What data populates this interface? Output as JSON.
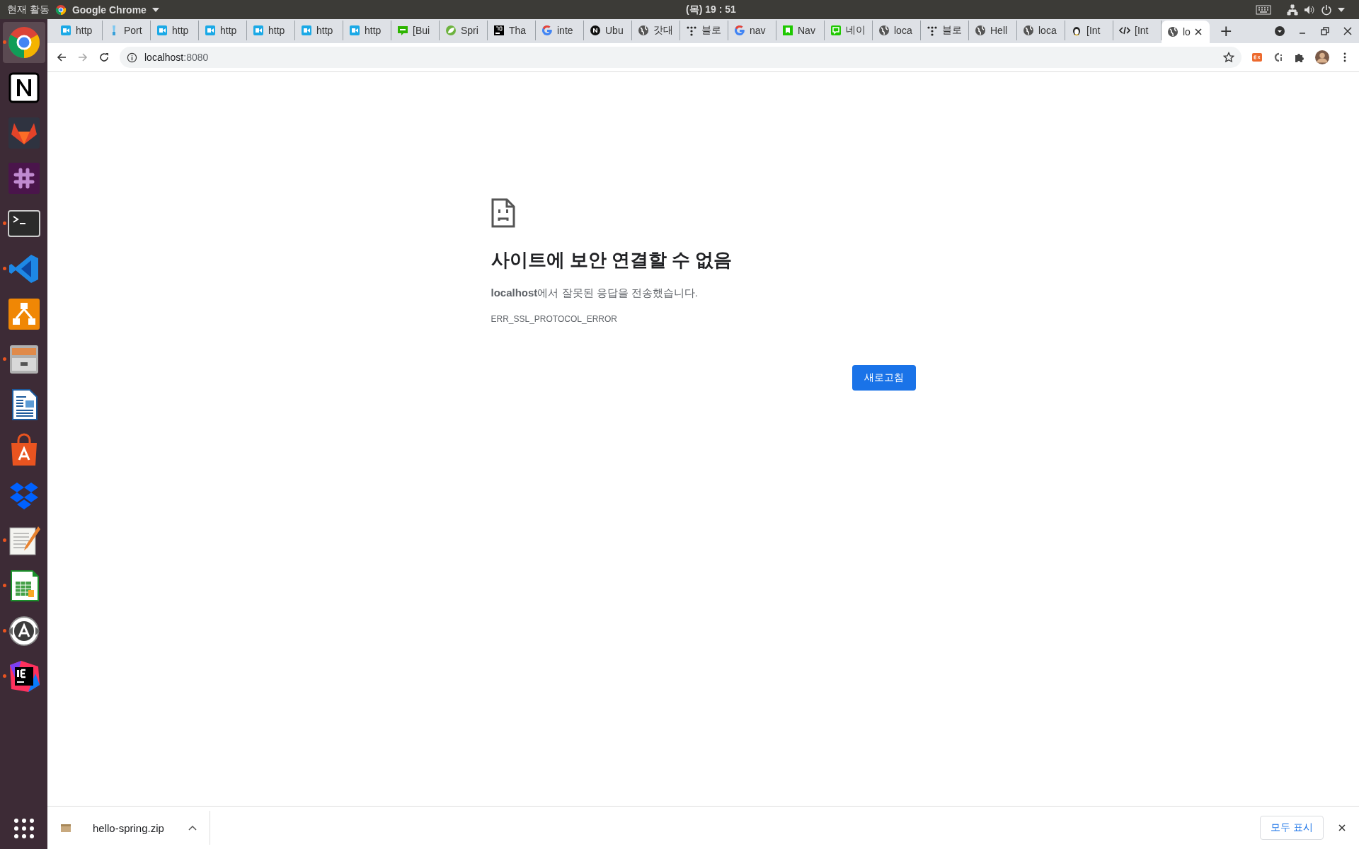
{
  "top_bar": {
    "activities": "현재 활동",
    "app_name": "Google Chrome",
    "clock": "(목) 19 : 51"
  },
  "dock": [
    {
      "kind": "browser",
      "running": true,
      "selected": true
    },
    {
      "kind": "notes",
      "running": false,
      "selected": false
    },
    {
      "kind": "fox",
      "running": false,
      "selected": false
    },
    {
      "kind": "chat",
      "running": false,
      "selected": false
    },
    {
      "kind": "terminal",
      "running": true,
      "selected": false
    },
    {
      "kind": "editor",
      "running": true,
      "selected": false
    },
    {
      "kind": "diagram",
      "running": false,
      "selected": false
    },
    {
      "kind": "cabinet",
      "running": true,
      "selected": false
    },
    {
      "kind": "document",
      "running": false,
      "selected": false
    },
    {
      "kind": "bag",
      "running": false,
      "selected": false
    },
    {
      "kind": "box",
      "running": false,
      "selected": false
    },
    {
      "kind": "notepad",
      "running": true,
      "selected": false
    },
    {
      "kind": "sheet",
      "running": true,
      "selected": false
    },
    {
      "kind": "updater",
      "running": true,
      "selected": false
    },
    {
      "kind": "ide",
      "running": true,
      "selected": false
    }
  ],
  "tabs": [
    {
      "title": "http",
      "kind": "video",
      "selected": false
    },
    {
      "title": "Port",
      "kind": "tool",
      "selected": false
    },
    {
      "title": "http",
      "kind": "video",
      "selected": false
    },
    {
      "title": "http",
      "kind": "video",
      "selected": false
    },
    {
      "title": "http",
      "kind": "video",
      "selected": false
    },
    {
      "title": "http",
      "kind": "video",
      "selected": false
    },
    {
      "title": "http",
      "kind": "video",
      "selected": false
    },
    {
      "title": "[Bui",
      "kind": "blog",
      "selected": false
    },
    {
      "title": "Spri",
      "kind": "leaf",
      "selected": false
    },
    {
      "title": "Tha",
      "kind": "jb",
      "selected": false
    },
    {
      "title": "inte",
      "kind": "g",
      "selected": false
    },
    {
      "title": "Ubu",
      "kind": "n",
      "selected": false
    },
    {
      "title": "갓대",
      "kind": "globe",
      "selected": false
    },
    {
      "title": "블로",
      "kind": "dots",
      "selected": false
    },
    {
      "title": "nav",
      "kind": "g",
      "selected": false
    },
    {
      "title": "Nav",
      "kind": "bookmark",
      "selected": false
    },
    {
      "title": "네이",
      "kind": "talk",
      "selected": false
    },
    {
      "title": "loca",
      "kind": "globe",
      "selected": false
    },
    {
      "title": "블로",
      "kind": "dots",
      "selected": false
    },
    {
      "title": "Hell",
      "kind": "globe",
      "selected": false
    },
    {
      "title": "loca",
      "kind": "globe",
      "selected": false
    },
    {
      "title": "[Int",
      "kind": "penguin",
      "selected": false
    },
    {
      "title": "[Int",
      "kind": "code",
      "selected": false
    },
    {
      "title": "lo",
      "kind": "globe",
      "selected": true
    }
  ],
  "new_tab": "+",
  "address_bar": {
    "host": "localhost",
    "port": ":8080"
  },
  "error_page": {
    "heading": "사이트에 보안 연결할 수 없음",
    "message": "**localhost**에서 잘못된 응답을 전송했습니다.",
    "code": "ERR_SSL_PROTOCOL_ERROR",
    "button": "새로고침"
  },
  "download_bar": {
    "file": "hello-spring.zip",
    "show_all": "모두 표시"
  }
}
